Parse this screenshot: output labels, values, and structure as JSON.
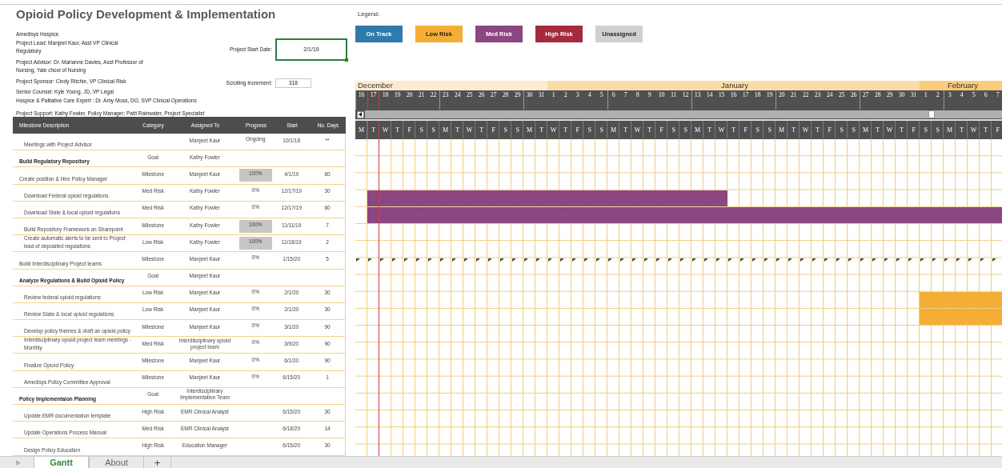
{
  "title": "Opioid Policy Development & Implementation",
  "project_info": {
    "organization": "Amedisys Hospice",
    "lead": "Project Lead: Manjeet Kaur, Asst VP Clinical Regulatory",
    "advisor": "Project Advisor: Dr. Marianne Davies, Asst Professor of Nursing, Yale chool of Nursing",
    "sponsor": "Project Sponsor: Cindy Ritchie, VP Clinical Risk",
    "senior_counsel": "Senior Counsel: Kyle Young,  JD, VP Legal",
    "care_expert": "Hospice & Palliative Care Expert : Dr. Amy Moss, DO, SVP Clinical Operations",
    "support": "Project Support: Kathy Fowler, Policy Manager; Patti Rainwater, Project Specialist"
  },
  "start_date": {
    "label": "Project Start Date:",
    "value": "2/1/19"
  },
  "scrolling_increment": {
    "label": "Scrolling Increment:",
    "value": "318"
  },
  "legend": {
    "label": "Legend:",
    "items": [
      {
        "label": "On Track",
        "color": "#2e7bac"
      },
      {
        "label": "Low Risk",
        "color": "#f5ae35"
      },
      {
        "label": "Med Risk",
        "color": "#8c4681"
      },
      {
        "label": "High Risk",
        "color": "#a5293f"
      },
      {
        "label": "Unassigned",
        "color": "#d0d0d0"
      }
    ]
  },
  "table": {
    "columns": [
      "Milestone Description",
      "Category",
      "Assigned To",
      "Progress",
      "Start",
      "No. Days"
    ],
    "rows": [
      {
        "description": "Meetings with Project Advisor",
        "kind": "task",
        "indented": true,
        "flag_markers": false,
        "assigned_to": "Manjeet Kaur",
        "progress": "Ongoing",
        "highlighted": false,
        "start": "10/1/18",
        "days": "**"
      },
      {
        "description": "Build Regulatory Repository",
        "kind": "goal",
        "indented": false,
        "flag_markers": false,
        "category": "Goal",
        "assigned_to": "Kathy Fowler"
      },
      {
        "description": "Create position & Hire Policy Manager",
        "kind": "task",
        "indented": false,
        "flag_markers": false,
        "category": "Milestone",
        "assigned_to": "Manjeet Kaur",
        "progress": "100%",
        "highlighted": true,
        "start": "4/1/19",
        "days": "60"
      },
      {
        "description": "Download Federal opioid regulations",
        "kind": "task",
        "indented": true,
        "flag_markers": false,
        "category": "Med Risk",
        "assigned_to": "Kathy Fowler",
        "progress": "0%",
        "highlighted": false,
        "start": "12/17/19",
        "days": "30",
        "color": "#8c4681"
      },
      {
        "description": "Download State & local opioid regulations",
        "kind": "task",
        "indented": true,
        "flag_markers": false,
        "category": "Med Risk",
        "assigned_to": "Kathy Fowler",
        "progress": "0%",
        "highlighted": false,
        "start": "12/17/19",
        "days": "60",
        "color": "#8c4681"
      },
      {
        "description": "Build Repository Framework on Sharepoint",
        "kind": "task",
        "indented": true,
        "flag_markers": false,
        "category": "Milestone",
        "assigned_to": "Kathy Fowler",
        "progress": "100%",
        "highlighted": true,
        "start": "11/11/19",
        "days": "7"
      },
      {
        "description": "Create automatic alerts to be sent to Project lead of deposited regulations",
        "kind": "task",
        "indented": true,
        "flag_markers": false,
        "category": "Low Risk",
        "assigned_to": "Kathy Fowler",
        "progress": "100%",
        "highlighted": true,
        "start": "11/18/19",
        "days": "2"
      },
      {
        "description": "Build Interdisciplinary Project teams",
        "kind": "task",
        "indented": false,
        "flag_markers": true,
        "category": "Milestone",
        "assigned_to": "Manjeet Kaur",
        "progress": "0%",
        "highlighted": false,
        "start": "1/15/20",
        "days": "5"
      },
      {
        "description": "Analyze Regulations & Build Opioid Policy",
        "kind": "goal",
        "indented": false,
        "flag_markers": false,
        "category": "Goal",
        "assigned_to": "Manjeet Kaur"
      },
      {
        "description": "Review federal opioid regulations",
        "kind": "task",
        "indented": true,
        "flag_markers": false,
        "category": "Low Risk",
        "assigned_to": "Manjeet Kaur",
        "progress": "0%",
        "highlighted": false,
        "start": "2/1/20",
        "days": "30",
        "color": "#f5ae35"
      },
      {
        "description": "Review State & local opioid regulations",
        "kind": "task",
        "indented": true,
        "flag_markers": false,
        "category": "Low Risk",
        "assigned_to": "Manjeet Kaur",
        "progress": "0%",
        "highlighted": false,
        "start": "2/1/20",
        "days": "30",
        "color": "#f5ae35"
      },
      {
        "description": "Develop policy themes & draft an opioid policy",
        "kind": "task",
        "indented": true,
        "flag_markers": false,
        "category": "Milestone",
        "assigned_to": "Manjeet Kaur",
        "progress": "0%",
        "highlighted": false,
        "start": "3/1/20",
        "days": "90"
      },
      {
        "description": "Interdisciplinary opioid project team meetings - Monthly",
        "kind": "task",
        "indented": true,
        "flag_markers": false,
        "category": "Med Risk",
        "assigned_to": "Interdisciplinary opioid project team",
        "progress": "0%",
        "highlighted": false,
        "start": "3/9/20",
        "days": "90"
      },
      {
        "description": "Finalize Opioid Policy",
        "kind": "task",
        "indented": true,
        "flag_markers": false,
        "category": "Milestone",
        "assigned_to": "Manjeet Kaur",
        "progress": "0%",
        "highlighted": false,
        "start": "6/1/20",
        "days": "90"
      },
      {
        "description": "Amedisys Policy Committee Approval",
        "kind": "task",
        "indented": true,
        "flag_markers": false,
        "category": "Milestone",
        "assigned_to": "Manjeet Kaur",
        "progress": "0%",
        "highlighted": false,
        "start": "6/15/20",
        "days": "1"
      },
      {
        "description": "Policy Implementaion Planning",
        "kind": "goal",
        "indented": false,
        "flag_markers": false,
        "category": "Goal",
        "assigned_to": "Interdisciplinary Implementation Team"
      },
      {
        "description": "Update EMR documentation template",
        "kind": "task",
        "indented": true,
        "flag_markers": false,
        "category": "High Risk",
        "assigned_to": "EMR Clinical Analyst",
        "start": "6/15/20",
        "days": "30"
      },
      {
        "description": "Update Operations Process Manual",
        "kind": "task",
        "indented": true,
        "flag_markers": false,
        "category": "Med Risk",
        "assigned_to": "EMR Clinical Analyst",
        "start": "6/18/20",
        "days": "14"
      },
      {
        "description": "Design Policy Education",
        "kind": "task",
        "indented": true,
        "flag_markers": false,
        "category": "High Risk",
        "assigned_to": "Education Manager",
        "start": "6/15/20",
        "days": "30"
      }
    ]
  },
  "timeline": {
    "months": [
      {
        "name": "December",
        "color": "#fdebd0",
        "days": [
          {
            "day": "16",
            "weekday": "M",
            "today": false
          },
          {
            "day": "17",
            "weekday": "T",
            "today": true
          },
          {
            "day": "18",
            "weekday": "W",
            "today": false
          },
          {
            "day": "19",
            "weekday": "T",
            "today": false
          },
          {
            "day": "20",
            "weekday": "F",
            "today": false
          },
          {
            "day": "21",
            "weekday": "S",
            "today": false
          },
          {
            "day": "22",
            "weekday": "S",
            "today": false
          },
          {
            "day": "23",
            "weekday": "M",
            "today": false
          },
          {
            "day": "24",
            "weekday": "T",
            "today": false
          },
          {
            "day": "25",
            "weekday": "W",
            "today": false
          },
          {
            "day": "26",
            "weekday": "T",
            "today": false
          },
          {
            "day": "27",
            "weekday": "F",
            "today": false
          },
          {
            "day": "28",
            "weekday": "S",
            "today": false
          },
          {
            "day": "29",
            "weekday": "S",
            "today": false
          },
          {
            "day": "30",
            "weekday": "M",
            "today": false
          },
          {
            "day": "31",
            "weekday": "T",
            "today": false
          }
        ]
      },
      {
        "name": "January",
        "color": "#fcdca6",
        "days": [
          {
            "day": "1",
            "weekday": "W",
            "today": false
          },
          {
            "day": "2",
            "weekday": "T",
            "today": false
          },
          {
            "day": "3",
            "weekday": "F",
            "today": false
          },
          {
            "day": "4",
            "weekday": "S",
            "today": false
          },
          {
            "day": "5",
            "weekday": "S",
            "today": false
          },
          {
            "day": "6",
            "weekday": "M",
            "today": false
          },
          {
            "day": "7",
            "weekday": "T",
            "today": false
          },
          {
            "day": "8",
            "weekday": "W",
            "today": false
          },
          {
            "day": "9",
            "weekday": "T",
            "today": false
          },
          {
            "day": "10",
            "weekday": "F",
            "today": false
          },
          {
            "day": "11",
            "weekday": "S",
            "today": false
          },
          {
            "day": "12",
            "weekday": "S",
            "today": false
          },
          {
            "day": "13",
            "weekday": "M",
            "today": false
          },
          {
            "day": "14",
            "weekday": "T",
            "today": false
          },
          {
            "day": "15",
            "weekday": "W",
            "today": false
          },
          {
            "day": "16",
            "weekday": "T",
            "today": false
          },
          {
            "day": "17",
            "weekday": "F",
            "today": false
          },
          {
            "day": "18",
            "weekday": "S",
            "today": false
          },
          {
            "day": "19",
            "weekday": "S",
            "today": false
          },
          {
            "day": "20",
            "weekday": "M",
            "today": false
          },
          {
            "day": "21",
            "weekday": "T",
            "today": false
          },
          {
            "day": "22",
            "weekday": "W",
            "today": false
          },
          {
            "day": "23",
            "weekday": "T",
            "today": false
          },
          {
            "day": "24",
            "weekday": "F",
            "today": false
          },
          {
            "day": "25",
            "weekday": "S",
            "today": false
          },
          {
            "day": "26",
            "weekday": "S",
            "today": false
          },
          {
            "day": "27",
            "weekday": "M",
            "today": false
          },
          {
            "day": "28",
            "weekday": "T",
            "today": false
          },
          {
            "day": "29",
            "weekday": "W",
            "today": false
          },
          {
            "day": "30",
            "weekday": "T",
            "today": false
          },
          {
            "day": "31",
            "weekday": "F",
            "today": false
          }
        ]
      },
      {
        "name": "February",
        "color": "#f9cb7b",
        "days": [
          {
            "day": "1",
            "weekday": "S",
            "today": false
          },
          {
            "day": "2",
            "weekday": "S",
            "today": false
          },
          {
            "day": "3",
            "weekday": "M",
            "today": false
          },
          {
            "day": "4",
            "weekday": "T",
            "today": false
          },
          {
            "day": "5",
            "weekday": "W",
            "today": false
          },
          {
            "day": "6",
            "weekday": "T",
            "today": false
          },
          {
            "day": "7",
            "weekday": "F",
            "today": false
          }
        ]
      }
    ]
  },
  "sheet_tabs": {
    "tabs": [
      {
        "label": "Gantt",
        "selected": true
      },
      {
        "label": "About",
        "selected": false
      }
    ],
    "add_label": "+"
  }
}
